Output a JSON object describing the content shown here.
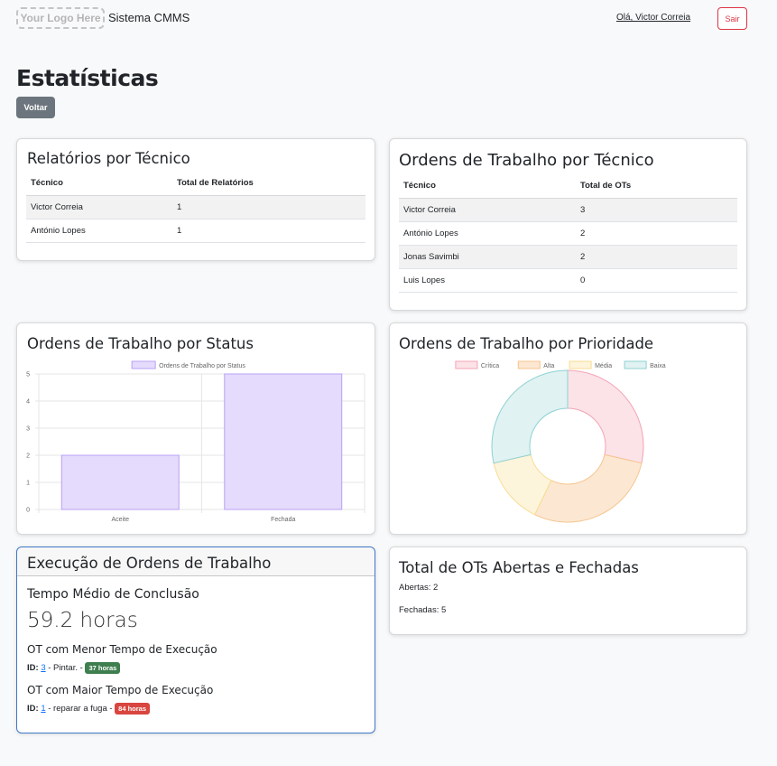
{
  "navbar": {
    "logo": "Your Logo Here",
    "brand": "Sistema CMMS",
    "user_greeting": "Olá, Victor Correia",
    "logout_label": "Sair"
  },
  "page": {
    "title": "Estatísticas",
    "back_label": "Voltar"
  },
  "reports_by_tech": {
    "title": "Relatórios por Técnico",
    "headers": [
      "Técnico",
      "Total de Relatórios"
    ],
    "rows": [
      [
        "Victor Correia",
        "1"
      ],
      [
        "António Lopes",
        "1"
      ]
    ]
  },
  "orders_by_tech": {
    "title": "Ordens de Trabalho por Técnico",
    "headers": [
      "Técnico",
      "Total de OTs"
    ],
    "rows": [
      [
        "Victor Correia",
        "3"
      ],
      [
        "António Lopes",
        "2"
      ],
      [
        "Jonas Savimbi",
        "2"
      ],
      [
        "Luis Lopes",
        "0"
      ]
    ]
  },
  "status_chart": {
    "title": "Ordens de Trabalho por Status"
  },
  "priority_chart": {
    "title": "Ordens de Trabalho por Prioridade"
  },
  "execution": {
    "title": "Execução de Ordens de Trabalho",
    "avg_label": "Tempo Médio de Conclusão",
    "avg_value": "59.2 horas",
    "min_label": "OT com Menor Tempo de Execução",
    "min_id_prefix": "ID:",
    "min_id": "3",
    "min_desc": " - Pintar. - ",
    "min_badge": "37 horas",
    "max_label": "OT com Maior Tempo de Execução",
    "max_id_prefix": "ID:",
    "max_id": "1",
    "max_desc": " - reparar a fuga - ",
    "max_badge": "84 horas"
  },
  "totals": {
    "title": "Total de OTs Abertas e Fechadas",
    "open": "Abertas: 2",
    "closed": "Fechadas: 5"
  },
  "colors": {
    "bar_fill": "#e5dbfc",
    "bar_stroke": "#b9a0f5",
    "exec_border": "#3f78c8",
    "danger": "#dc3545"
  },
  "chart_data": [
    {
      "type": "bar",
      "legend": "Ordens de Trabalho por Status",
      "categories": [
        "Aceite",
        "Fechada"
      ],
      "values": [
        2,
        5
      ],
      "ylim": [
        0,
        5
      ],
      "yticks": [
        "0",
        "1",
        "2",
        "3",
        "4",
        "5"
      ],
      "grid": true,
      "legend_position": "top"
    },
    {
      "type": "pie",
      "variant": "doughnut",
      "labels": [
        "Crítica",
        "Alta",
        "Média",
        "Baixa"
      ],
      "values": [
        2,
        2,
        1,
        2
      ],
      "fills": [
        "#fbe3e8",
        "#fce8d2",
        "#fdf4dc",
        "#e0f2f2"
      ],
      "strokes": [
        "#f4a3b5",
        "#f7c48e",
        "#f9dd92",
        "#8fd1d1"
      ],
      "legend_position": "top"
    }
  ]
}
